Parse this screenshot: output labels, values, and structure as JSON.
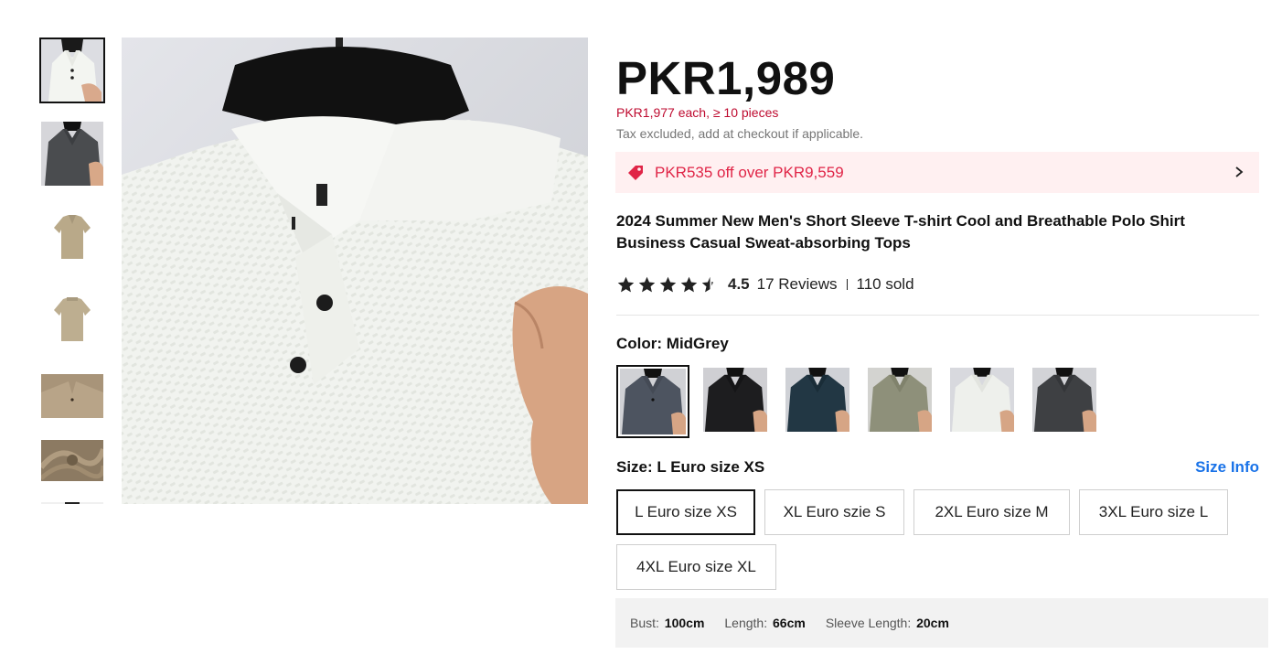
{
  "product": {
    "price": "PKR1,989",
    "bulk_price": "PKR1,977 each, ≥ 10 pieces",
    "tax_note": "Tax excluded, add at checkout if applicable.",
    "promo": "PKR535 off over PKR9,559",
    "title": "2024 Summer New Men's Short Sleeve T-shirt Cool and Breathable Polo Shirt Business Casual Sweat-absorbing Tops",
    "rating_value": "4.5",
    "rating_stars": 4.5,
    "reviews": "17 Reviews",
    "sold": "110 sold"
  },
  "gallery": {
    "thumbnails": [
      "white-polo",
      "grey-polo-hand",
      "khaki-polo-front",
      "khaki-polo-back",
      "khaki-collar",
      "khaki-fabric-swirl",
      "partial-thumbnail"
    ],
    "selected_index": 0
  },
  "color": {
    "label_prefix": "Color:",
    "selected": "MidGrey",
    "options": [
      "MidGrey",
      "Black",
      "Navy",
      "Olive",
      "White",
      "Charcoal"
    ]
  },
  "size": {
    "label_prefix": "Size:",
    "selected": "L Euro size XS",
    "info_link": "Size Info",
    "options": [
      "L Euro size XS",
      "XL Euro szie S",
      "2XL Euro size M",
      "3XL Euro size L",
      "4XL Euro size XL"
    ]
  },
  "measurements": [
    {
      "label": "Bust:",
      "value": "100cm"
    },
    {
      "label": "Length:",
      "value": "66cm"
    },
    {
      "label": "Sleeve Length:",
      "value": "20cm"
    }
  ],
  "colors": {
    "price_red": "#be0a2f",
    "promo_bg": "#fff0f1",
    "promo_text": "#e02547",
    "link_blue": "#1a73e8"
  }
}
